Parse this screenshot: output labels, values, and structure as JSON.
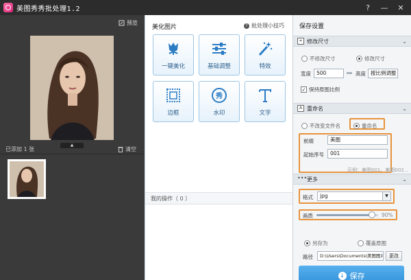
{
  "app": {
    "title": "美图秀秀批处理1.2"
  },
  "left": {
    "preview_label": "预览",
    "added_label": "已添加 1 张",
    "clear_label": "清空",
    "collapse_symbol": "▲"
  },
  "middle": {
    "header": "美化图片",
    "tips": "批处理小技巧",
    "tools": [
      {
        "label": "一键美化",
        "icon": "tulip-icon"
      },
      {
        "label": "基础调整",
        "icon": "sliders-icon"
      },
      {
        "label": "特效",
        "icon": "magic-wand-icon"
      },
      {
        "label": "边框",
        "icon": "frame-icon"
      },
      {
        "label": "水印",
        "icon": "watermark-stamp-icon"
      },
      {
        "label": "文字",
        "icon": "text-icon"
      }
    ],
    "ops_label": "我的操作（ 0 ）"
  },
  "right": {
    "header": "保存设置",
    "size_section": "修改尺寸",
    "no_resize": "不修改尺寸",
    "resize": "修改尺寸",
    "width_label": "宽度",
    "width_value": "500",
    "height_label": "高度",
    "height_value": "按比例调整",
    "keep_ratio": "保持原图比例",
    "rename_section": "重命名",
    "no_rename": "不改变文件名",
    "rename": "重命名",
    "prefix_label": "前缀",
    "prefix_value": "美图",
    "start_label": "起始序号",
    "start_value": "001",
    "example": "示例：美图001、美图002...",
    "more_section": "更多",
    "format_label": "格式",
    "format_value": "jpg",
    "quality_label": "画质",
    "quality_value": "90%",
    "quality_fraction": 0.9,
    "save_as": "另存为",
    "overwrite": "覆盖原图",
    "path_label": "路径",
    "path_value": "D:\\Users\\Documents\\美图图片",
    "change_btn": "更改",
    "save_btn": "保存"
  },
  "colors": {
    "accent": "#2f8ed7",
    "highlight": "#e8923a",
    "dark_panel": "#3a3a3a"
  }
}
